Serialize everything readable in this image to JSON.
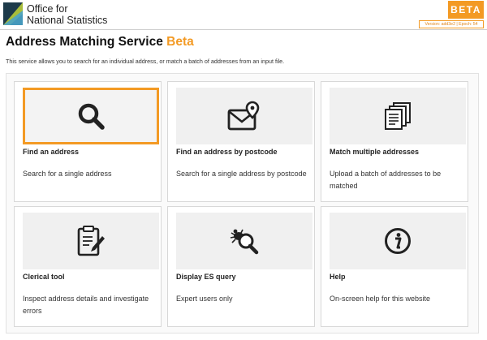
{
  "header": {
    "org_line1": "Office for",
    "org_line2": "National Statistics",
    "beta_badge": "BETA",
    "version": "Version: add3e2 | Epoch: 54"
  },
  "page": {
    "title": "Address Matching Service",
    "title_accent": "Beta",
    "intro": "This service allows you to search for an individual address, or match a batch of addresses from an input file."
  },
  "cards": [
    {
      "title": "Find an address",
      "description": "Search for a single address",
      "icon": "search-icon"
    },
    {
      "title": "Find an address by postcode",
      "description": "Search for a single address by postcode",
      "icon": "envelope-location-icon"
    },
    {
      "title": "Match multiple addresses",
      "description": "Upload a batch of addresses to be matched",
      "icon": "documents-icon"
    },
    {
      "title": "Clerical tool",
      "description": "Inspect address details and investigate errors",
      "icon": "clipboard-edit-icon"
    },
    {
      "title": "Display ES query",
      "description": "Expert users only",
      "icon": "bug-search-icon"
    },
    {
      "title": "Help",
      "description": "On-screen help for this website",
      "icon": "info-icon"
    }
  ],
  "colors": {
    "accent": "#f39a24",
    "logo_green": "#a8bd3a",
    "logo_dark": "#1d3a4a"
  }
}
